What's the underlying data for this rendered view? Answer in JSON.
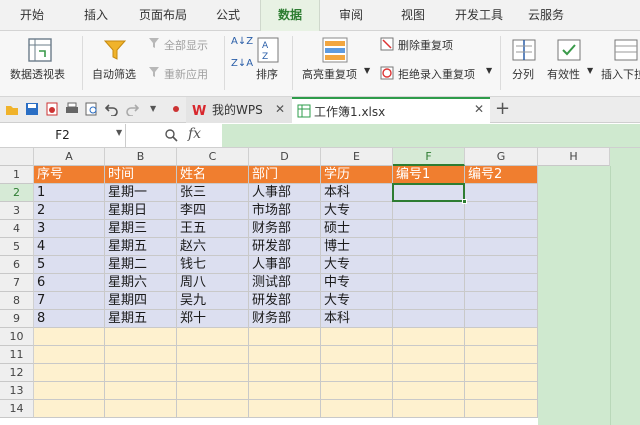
{
  "menu": {
    "tabs": [
      "开始",
      "插入",
      "页面布局",
      "公式",
      "数据",
      "审阅",
      "视图",
      "开发工具",
      "云服务"
    ],
    "active": "数据"
  },
  "ribbon": {
    "pivot": "数据透视表",
    "autofilter": "自动筛选",
    "show_all": "全部显示",
    "reapply": "重新应用",
    "sort_asc": "A↓Z",
    "sort_desc": "Z↓A",
    "sort": "排序",
    "highlight_dup": "高亮重复项",
    "remove_dup": "删除重复项",
    "reject_dup": "拒绝录入重复项",
    "split": "分列",
    "validity": "有效性",
    "insert_dropdown": "插入下拉"
  },
  "toolbar": {
    "wps_tab": "我的WPS",
    "doc_tab": "工作簿1.xlsx"
  },
  "formula_bar": {
    "name_box": "F2",
    "fx": "fx",
    "content": ""
  },
  "sheet": {
    "columns": [
      "A",
      "B",
      "C",
      "D",
      "E",
      "F",
      "G",
      "H"
    ],
    "headers": [
      "序号",
      "时间",
      "姓名",
      "部门",
      "学历",
      "编号1",
      "编号2"
    ],
    "rows": [
      [
        "1",
        "星期一",
        "张三",
        "人事部",
        "本科"
      ],
      [
        "2",
        "星期日",
        "李四",
        "市场部",
        "大专"
      ],
      [
        "3",
        "星期三",
        "王五",
        "财务部",
        "硕士"
      ],
      [
        "4",
        "星期五",
        "赵六",
        "研发部",
        "博士"
      ],
      [
        "5",
        "星期二",
        "钱七",
        "人事部",
        "大专"
      ],
      [
        "6",
        "星期六",
        "周八",
        "测试部",
        "中专"
      ],
      [
        "7",
        "星期四",
        "吴九",
        "研发部",
        "大专"
      ],
      [
        "8",
        "星期五",
        "郑十",
        "财务部",
        "本科"
      ]
    ],
    "row_numbers": [
      "1",
      "2",
      "3",
      "4",
      "5",
      "6",
      "7",
      "8",
      "9",
      "10",
      "11",
      "12",
      "13",
      "14"
    ],
    "selected_cell": "F2"
  },
  "colors": {
    "header_fill": "#f07e2f",
    "data_fill": "#dcdff0",
    "empty_fill": "#fef1cf",
    "green": "#cfe9cf",
    "accent": "#2e7d32"
  }
}
